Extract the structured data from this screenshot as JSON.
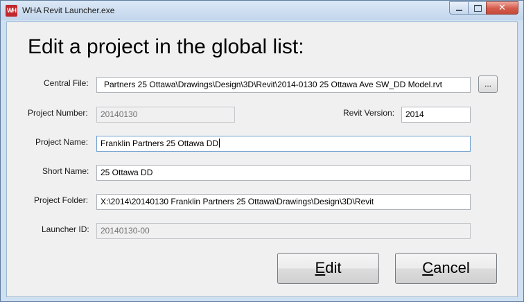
{
  "window": {
    "title": "WHA Revit Launcher.exe",
    "icon_text": "WH"
  },
  "titlebar_buttons": {
    "close_glyph": "✕"
  },
  "form": {
    "heading": "Edit a project in the global list:",
    "central_file": {
      "label": "Central File:",
      "value": "Partners 25 Ottawa\\Drawings\\Design\\3D\\Revit\\2014-0130 25 Ottawa Ave SW_DD Model.rvt"
    },
    "browse_label": "...",
    "project_number": {
      "label": "Project Number:",
      "value": "20140130"
    },
    "revit_version": {
      "label": "Revit Version:",
      "value": "2014"
    },
    "project_name": {
      "label": "Project Name:",
      "value": "Franklin Partners 25 Ottawa DD"
    },
    "short_name": {
      "label": "Short Name:",
      "value": "25 Ottawa DD"
    },
    "project_folder": {
      "label": "Project Folder:",
      "value": "X:\\2014\\20140130 Franklin Partners 25 Ottawa\\Drawings\\Design\\3D\\Revit"
    },
    "launcher_id": {
      "label": "Launcher ID:",
      "value": "20140130-00"
    }
  },
  "buttons": {
    "edit": {
      "mnemonic": "E",
      "rest": "dit"
    },
    "cancel": {
      "mnemonic": "C",
      "rest": "ancel"
    }
  }
}
